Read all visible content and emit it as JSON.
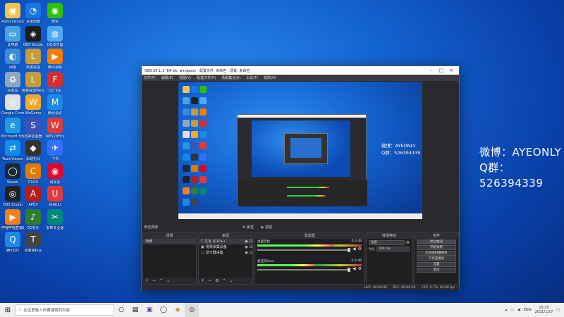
{
  "desktop_icons": [
    {
      "label": "Administrator",
      "name": "admin-folder-icon",
      "color": "#f2c14e",
      "glyph": "▣"
    },
    {
      "label": "百度网盘",
      "name": "baidu-netdisk-icon",
      "color": "#1a73e8",
      "glyph": "◔"
    },
    {
      "label": "微信",
      "name": "wechat-icon",
      "color": "#2dc100",
      "glyph": "◉"
    },
    {
      "label": "此电脑",
      "name": "this-pc-icon",
      "color": "#4aa3df",
      "glyph": "▭"
    },
    {
      "label": "OBS Studio",
      "name": "game-icon-1",
      "color": "#1d1d1d",
      "glyph": "◈"
    },
    {
      "label": "QQ浏览器",
      "name": "qq-browser-icon",
      "color": "#4fa8f6",
      "glyph": "◍"
    },
    {
      "label": "网络",
      "name": "network-icon",
      "color": "#3d8bd6",
      "glyph": "◐"
    },
    {
      "label": "英雄联盟",
      "name": "lol-icon",
      "color": "#c69b3a",
      "glyph": "L"
    },
    {
      "label": "腾讯视频",
      "name": "tencent-video-icon",
      "color": "#f57c00",
      "glyph": "▶"
    },
    {
      "label": "回收站",
      "name": "recycle-bin-icon",
      "color": "#8fa7bd",
      "glyph": "♻"
    },
    {
      "label": "英雄联盟WeGame版",
      "name": "lol-wegame-icon",
      "color": "#c69b3a",
      "glyph": "L"
    },
    {
      "label": "QQ飞车",
      "name": "qq-speed-icon",
      "color": "#d32f2f",
      "glyph": "F"
    },
    {
      "label": "Google Chrome",
      "name": "chrome-icon",
      "color": "#e0e0e0",
      "glyph": "◎"
    },
    {
      "label": "WeGame",
      "name": "wegame-icon",
      "color": "#f9a825",
      "glyph": "W"
    },
    {
      "label": "腾讯会议",
      "name": "tencent-meeting-icon",
      "color": "#1e88e5",
      "glyph": "M"
    },
    {
      "label": "Microsoft Edge",
      "name": "edge-icon",
      "color": "#1e9be0",
      "glyph": "e"
    },
    {
      "label": "雷神加速器",
      "name": "accelerator-icon",
      "color": "#3f51b5",
      "glyph": "S"
    },
    {
      "label": "WPS Office",
      "name": "wps-icon",
      "color": "#e53935",
      "glyph": "W"
    },
    {
      "label": "TeamViewer",
      "name": "teamviewer-icon",
      "color": "#0e8ee9",
      "glyph": "⇄"
    },
    {
      "label": "永劫无间",
      "name": "game-icon-2",
      "color": "#333",
      "glyph": "◆"
    },
    {
      "label": "飞书",
      "name": "feishu-icon",
      "color": "#3370ff",
      "glyph": "✈"
    },
    {
      "label": "Steam",
      "name": "steam-icon",
      "color": "#1b2838",
      "glyph": "◯"
    },
    {
      "label": "CSGO",
      "name": "csgo-icon",
      "color": "#e07b00",
      "glyph": "C"
    },
    {
      "label": "网易云",
      "name": "netease-music-icon",
      "color": "#e60026",
      "glyph": "◉"
    },
    {
      "label": "OBS Studio",
      "name": "obs-icon",
      "color": "#222",
      "glyph": "◎"
    },
    {
      "label": "APEX",
      "name": "apex-icon",
      "color": "#b71c1c",
      "glyph": "A"
    },
    {
      "label": "网易UU",
      "name": "uu-icon",
      "color": "#e53935",
      "glyph": "U"
    },
    {
      "label": "哔哩哔哩直播姬",
      "name": "bili-live-icon",
      "color": "#f57f17",
      "glyph": "▶"
    },
    {
      "label": "QQ音乐",
      "name": "qq-music-icon",
      "color": "#2e7d32",
      "glyph": "♪"
    },
    {
      "label": "剪映专业版",
      "name": "jianying-icon",
      "color": "#00897b",
      "glyph": "✂"
    },
    {
      "label": "腾讯QQ",
      "name": "qq-icon",
      "color": "#1e88e5",
      "glyph": "Q"
    },
    {
      "label": "逃离塔科夫",
      "name": "tarkov-icon",
      "color": "#444",
      "glyph": "T"
    }
  ],
  "overlay": {
    "weibo": "微博：AYEONLY",
    "qq_group": "Q群：526394339"
  },
  "obs": {
    "title": "OBS 26.1.1 (64-bit, windows) - 配置文件: 未命名 - 场景: 未命名",
    "menu": [
      "文件(F)",
      "编辑(E)",
      "视图(V)",
      "配置文件(P)",
      "场景集合(S)",
      "工具(T)",
      "帮助(H)"
    ],
    "preview_text": {
      "weibo": "微博：AYEONLY",
      "qq_group": "Q群：526394339"
    },
    "scene_bar": {
      "no_source": "未选择源",
      "properties": "属性",
      "filters": "滤镜"
    },
    "scenes": {
      "header": "场景",
      "items": [
        "场景"
      ]
    },
    "sources": {
      "header": "来源",
      "items": [
        "文本 (GDI+)",
        "视频采集设备",
        "显示器采集"
      ]
    },
    "mixer": {
      "header": "混音器",
      "channels": [
        {
          "name": "桌面音频",
          "db": "0.0 dB",
          "level": 0.72
        },
        {
          "name": "麦克风/Aux",
          "db": "0.0 dB",
          "level": 0.55
        }
      ]
    },
    "transitions": {
      "header": "转场特效",
      "type": "淡出",
      "duration_label": "时长",
      "duration": "300 ms"
    },
    "controls": {
      "header": "控件",
      "buttons": [
        "停止推流",
        "开始录制",
        "启动虚拟摄像机",
        "工作室模式",
        "设置",
        "退出"
      ]
    },
    "status": {
      "live": "LIVE: 00:00:00",
      "rec": "REC: 00:00:00",
      "cpu": "CPU: 0.7%, 60.00 fps"
    }
  },
  "taskbar": {
    "search_placeholder": "在这里输入你要搜索的内容",
    "lang": "ENG",
    "time": "20:25",
    "date": "2021/1/27"
  }
}
